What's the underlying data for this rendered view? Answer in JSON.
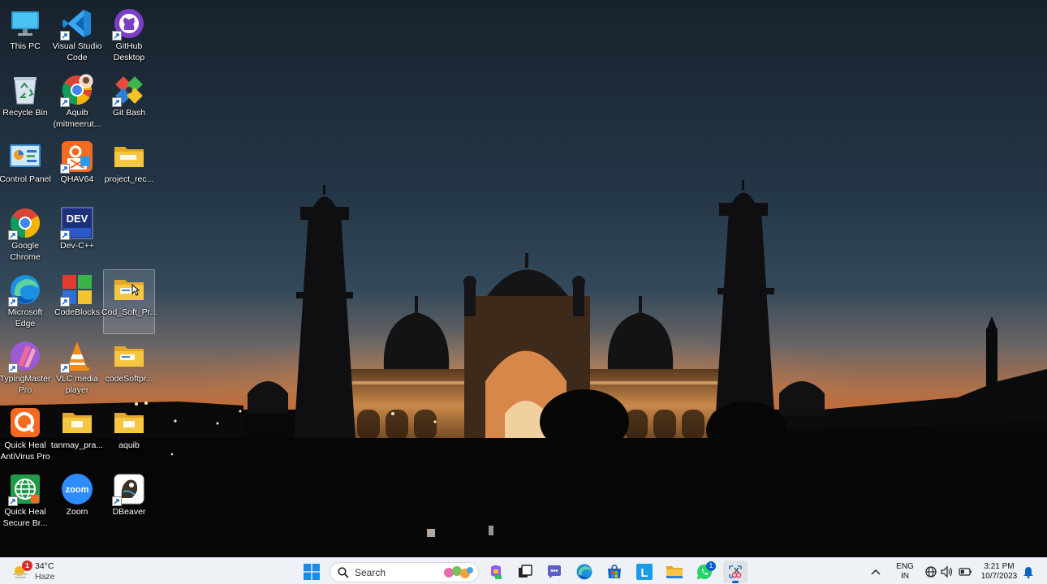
{
  "desktop": {
    "icons": [
      {
        "id": "this-pc",
        "label": "This PC"
      },
      {
        "id": "vscode",
        "label": "Visual Studio\nCode"
      },
      {
        "id": "github-desktop",
        "label": "GitHub\nDesktop"
      },
      {
        "id": "recycle-bin",
        "label": "Recycle Bin"
      },
      {
        "id": "chrome-profile",
        "label": "Aquib\n(mitmeerut..."
      },
      {
        "id": "git-bash",
        "label": "Git Bash"
      },
      {
        "id": "control-panel",
        "label": "Control Panel"
      },
      {
        "id": "qhav64",
        "label": "QHAV64"
      },
      {
        "id": "project-rec",
        "label": "project_rec..."
      },
      {
        "id": "google-chrome",
        "label": "Google\nChrome"
      },
      {
        "id": "dev-cpp",
        "label": "Dev-C++"
      },
      {
        "id": "microsoft-edge",
        "label": "Microsoft\nEdge"
      },
      {
        "id": "codeblocks",
        "label": "CodeBlocks"
      },
      {
        "id": "cod-soft",
        "label": "Cod_Soft_Pr..."
      },
      {
        "id": "typingmaster",
        "label": "TypingMaster\nPro"
      },
      {
        "id": "vlc",
        "label": "VLC media\nplayer"
      },
      {
        "id": "codesoftpr",
        "label": "codeSoftpr..."
      },
      {
        "id": "quickheal-av",
        "label": "Quick Heal\nAntiVirus Pro"
      },
      {
        "id": "tanmay",
        "label": "tanmay_pra..."
      },
      {
        "id": "aquib",
        "label": "aquib"
      },
      {
        "id": "quickheal-browser",
        "label": "Quick Heal\nSecure Br..."
      },
      {
        "id": "zoom",
        "label": "Zoom"
      },
      {
        "id": "dbeaver",
        "label": "DBeaver"
      }
    ],
    "dev_icon_text": "DEV",
    "zoom_icon_text": "zoom"
  },
  "taskbar": {
    "weather": {
      "temp": "34°C",
      "condition": "Haze",
      "badge": "1"
    },
    "search_placeholder": "Search",
    "whatsapp_badge": "1",
    "launcher_letter": "L",
    "language": {
      "line1": "ENG",
      "line2": "IN"
    },
    "clock": {
      "time": "3:21 PM",
      "date": "10/7/2023"
    }
  },
  "colors": {
    "taskbar_bg": "#eef1f5",
    "accent": "#0a62c9",
    "folder": "#f6c542"
  }
}
